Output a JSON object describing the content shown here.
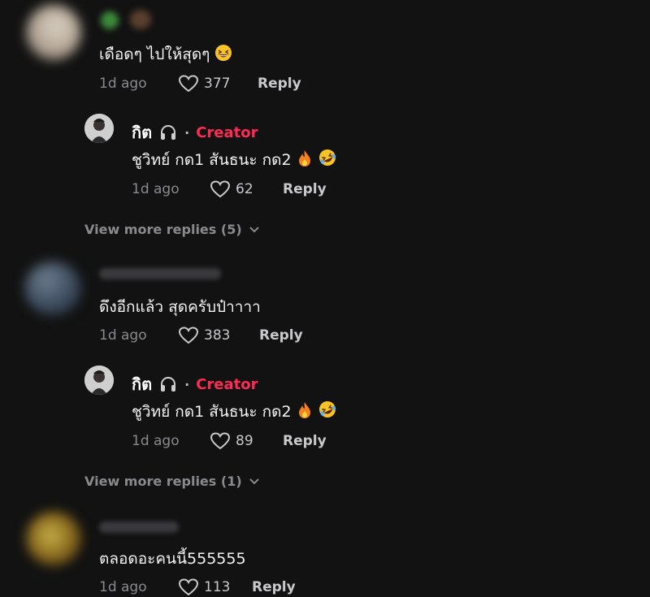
{
  "comments": [
    {
      "text": "เดือดๆ ไปให้สุดๆ",
      "time": "1d ago",
      "likes": "377",
      "reply_label": "Reply",
      "creator_reply": {
        "name": "กิต",
        "badge": "Creator",
        "text": "ชูวิทย์ กด1 สันธนะ กด2",
        "time": "1d ago",
        "likes": "62",
        "reply_label": "Reply"
      },
      "view_more": "View more replies (5)"
    },
    {
      "text": "ดึงอีกแล้ว สุดครับป๋าาาา",
      "time": "1d ago",
      "likes": "383",
      "reply_label": "Reply",
      "creator_reply": {
        "name": "กิต",
        "badge": "Creator",
        "text": "ชูวิทย์ กด1 สันธนะ กด2",
        "time": "1d ago",
        "likes": "89",
        "reply_label": "Reply"
      },
      "view_more": "View more replies (1)"
    },
    {
      "text": "ตลอดอะคนนี้555555",
      "time": "1d ago",
      "likes": "113",
      "reply_label": "Reply"
    }
  ],
  "colors": {
    "background": "#121212",
    "creator_badge": "#fe2c55",
    "muted": "#8a8a8e"
  }
}
